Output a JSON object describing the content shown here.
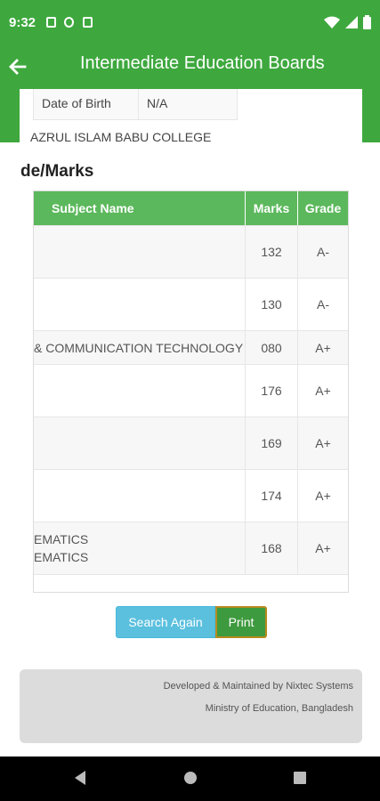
{
  "status": {
    "time": "9:32"
  },
  "appbar": {
    "title": "Intermediate Education Boards"
  },
  "student": {
    "dob_label": "Date of Birth",
    "dob_value": "N/A",
    "college": "AZRUL ISLAM BABU COLLEGE"
  },
  "section_title": "de/Marks",
  "table": {
    "headers": {
      "subject": "Subject Name",
      "marks": "Marks",
      "grade": "Grade"
    },
    "rows": [
      {
        "subject": "",
        "subject2": "",
        "marks": "132",
        "grade": "A-"
      },
      {
        "subject": "",
        "subject2": "",
        "marks": "130",
        "grade": "A-"
      },
      {
        "subject": "& COMMUNICATION TECHNOLOGY",
        "subject2": "",
        "marks": "080",
        "grade": "A+"
      },
      {
        "subject": "",
        "subject2": "",
        "marks": "176",
        "grade": "A+"
      },
      {
        "subject": "",
        "subject2": "",
        "marks": "169",
        "grade": "A+"
      },
      {
        "subject": "",
        "subject2": "",
        "marks": "174",
        "grade": "A+"
      },
      {
        "subject": "EMATICS",
        "subject2": "EMATICS",
        "marks": "168",
        "grade": "A+"
      }
    ]
  },
  "buttons": {
    "search_again": "Search Again",
    "print": "Print"
  },
  "footer": {
    "line1": "Developed & Maintained by Nixtec Systems",
    "line2": "Ministry of Education, Bangladesh"
  },
  "colors": {
    "primary": "#3ea83e",
    "table_header": "#5cb85c",
    "search_btn": "#5bc0de",
    "print_btn": "#3e9a3e"
  },
  "icons": {
    "back": "arrow-left-icon",
    "wifi": "wifi-icon",
    "signal": "signal-icon",
    "battery": "battery-icon"
  }
}
